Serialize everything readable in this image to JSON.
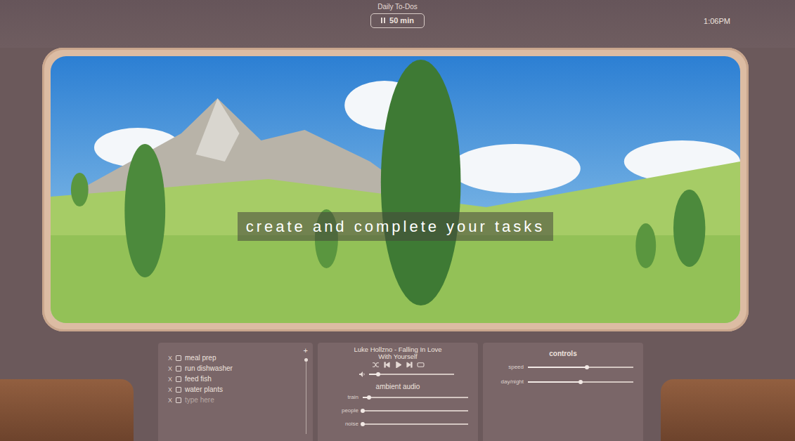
{
  "header": {
    "title": "Daily To-Dos",
    "timer": "50 min",
    "clock": "1:06PM"
  },
  "caption": "create and complete your tasks",
  "todos": {
    "add": "+",
    "items": [
      {
        "remove": "X",
        "text": "meal prep",
        "checked": false,
        "kind": "task"
      },
      {
        "remove": "X",
        "text": "run dishwasher",
        "checked": false,
        "kind": "task"
      },
      {
        "remove": "X",
        "text": "feed fish",
        "checked": false,
        "kind": "task"
      },
      {
        "remove": "X",
        "text": "water plants",
        "checked": false,
        "kind": "task"
      },
      {
        "remove": "X",
        "text": "type here",
        "checked": false,
        "kind": "input"
      }
    ]
  },
  "player": {
    "track": "Luke Hollzno - Falling In Love With Yourself",
    "volume": 0.11
  },
  "ambient": {
    "title": "ambient audio",
    "sliders": [
      {
        "label": "train",
        "level": 0.06
      },
      {
        "label": "people",
        "level": 0
      },
      {
        "label": "noise",
        "level": 0
      }
    ]
  },
  "controls": {
    "title": "controls",
    "sliders": [
      {
        "label": "speed",
        "level": 0.56
      },
      {
        "label": "day/night",
        "level": 0.5
      }
    ]
  }
}
